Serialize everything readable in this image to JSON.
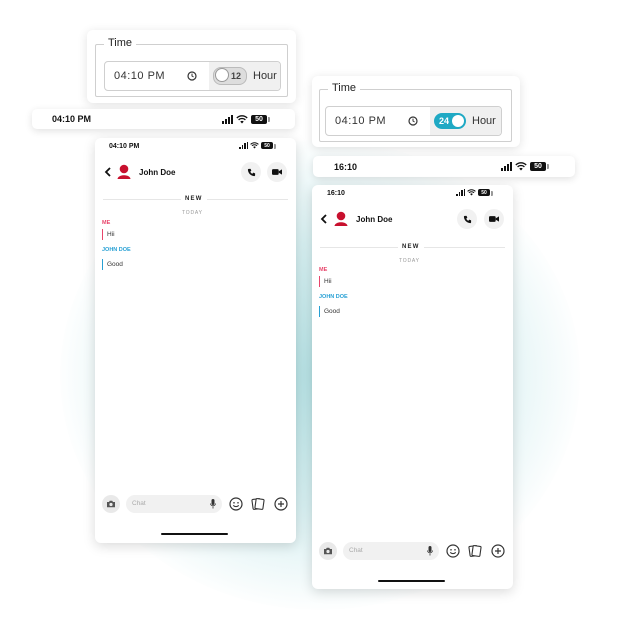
{
  "colors": {
    "accent": "#1fa9c4",
    "me": "#e8456b",
    "john": "#27a0d4",
    "avatar": "#c8102e",
    "toggle_off": "#777777"
  },
  "time_12": {
    "legend": "Time",
    "value": "04:10 PM",
    "toggle_label": "12",
    "toggle_state": "off",
    "hour_label": "Hour"
  },
  "time_24": {
    "legend": "Time",
    "value": "04:10 PM",
    "toggle_label": "24",
    "toggle_state": "on",
    "hour_label": "Hour"
  },
  "statusbar_12": {
    "time": "04:10 PM",
    "battery": "50"
  },
  "statusbar_24": {
    "time": "16:10",
    "battery": "50"
  },
  "phone_12": {
    "status_time": "04:10 PM",
    "battery": "50",
    "contact": "John Doe",
    "new_label": "NEW",
    "today_label": "TODAY",
    "messages": [
      {
        "sender": "ME",
        "text": "Hii"
      },
      {
        "sender": "JOHN DOE",
        "text": "Good"
      }
    ],
    "chat_placeholder": "Chat"
  },
  "phone_24": {
    "status_time": "16:10",
    "battery": "50",
    "contact": "John Doe",
    "new_label": "NEW",
    "today_label": "TODAY",
    "messages": [
      {
        "sender": "ME",
        "text": "Hii"
      },
      {
        "sender": "JOHN DOE",
        "text": "Good"
      }
    ],
    "chat_placeholder": "Chat"
  },
  "icons": {
    "clock": "clock-icon",
    "wifi": "wifi-icon",
    "signal": "signal-icon",
    "battery": "battery-icon",
    "back": "chevron-left-icon",
    "avatar": "avatar-icon",
    "phone": "phone-icon",
    "video": "video-camera-icon",
    "camera": "camera-icon",
    "mic": "microphone-icon",
    "emoji": "emoji-icon",
    "sticker": "sticker-icon",
    "plus": "plus-circle-icon"
  }
}
